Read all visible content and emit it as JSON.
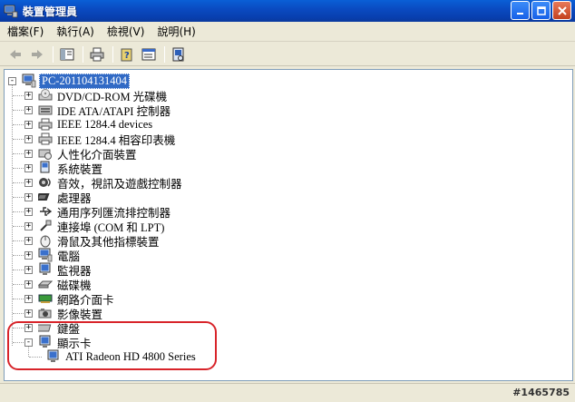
{
  "window": {
    "title": "裝置管理員"
  },
  "menu": [
    {
      "label": "檔案(F)"
    },
    {
      "label": "執行(A)"
    },
    {
      "label": "檢視(V)"
    },
    {
      "label": "說明(H)"
    }
  ],
  "tree": {
    "root": "PC-201104131404",
    "categories": [
      {
        "label": "DVD/CD-ROM 光碟機",
        "icon": "dvd-drive-icon"
      },
      {
        "label": "IDE ATA/ATAPI 控制器",
        "icon": "ide-controller-icon"
      },
      {
        "label": "IEEE 1284.4 devices",
        "icon": "printer-device-icon"
      },
      {
        "label": "IEEE 1284.4 相容印表機",
        "icon": "printer-device-icon"
      },
      {
        "label": "人性化介面裝置",
        "icon": "hid-icon"
      },
      {
        "label": "系統裝置",
        "icon": "system-device-icon"
      },
      {
        "label": "音效，視訊及遊戲控制器",
        "icon": "audio-icon"
      },
      {
        "label": "處理器",
        "icon": "processor-icon"
      },
      {
        "label": "通用序列匯流排控制器",
        "icon": "usb-icon"
      },
      {
        "label": "連接埠 (COM 和 LPT)",
        "icon": "port-icon"
      },
      {
        "label": "滑鼠及其他指標裝置",
        "icon": "mouse-icon"
      },
      {
        "label": "電腦",
        "icon": "computer-icon"
      },
      {
        "label": "監視器",
        "icon": "monitor-icon"
      },
      {
        "label": "磁碟機",
        "icon": "disk-drive-icon"
      },
      {
        "label": "網路介面卡",
        "icon": "network-adapter-icon"
      },
      {
        "label": "影像裝置",
        "icon": "imaging-device-icon"
      },
      {
        "label": "鍵盤",
        "icon": "keyboard-icon"
      },
      {
        "label": "顯示卡",
        "icon": "display-adapter-icon"
      }
    ],
    "display_child": "ATI Radeon HD 4800 Series"
  },
  "watermark": "#1465785",
  "colors": {
    "titlebar": "#0a4bc2",
    "selection": "#316ac5",
    "annotation": "#d8242a"
  }
}
